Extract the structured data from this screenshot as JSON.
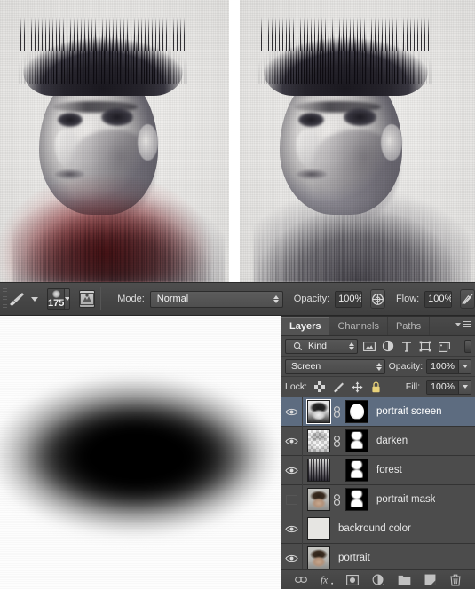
{
  "canvas": {
    "left_image": {
      "label": "portrait-with-red-overlay",
      "description": "Double exposure portrait, forest canopy hair, red painted wash over shoulders"
    },
    "right_image": {
      "label": "portrait-final-monochrome",
      "description": "Double exposure portrait, forest canopy hair and forest shoulders, no red"
    },
    "mask_preview": {
      "label": "soft-black-brush-blob-on-white"
    }
  },
  "options_bar": {
    "brush_preset_name": "brush-preset",
    "brush_size": "175",
    "brush_panel_icon": "brush-panel-icon",
    "mode_label": "Mode:",
    "mode_value": "Normal",
    "opacity_label": "Opacity:",
    "opacity_value": "100%",
    "airbrush_icon": "airbrush-icon",
    "flow_label": "Flow:",
    "flow_value": "100%",
    "pressure_icon": "pressure-size-icon"
  },
  "layers_panel": {
    "tabs": [
      {
        "label": "Layers",
        "active": true
      },
      {
        "label": "Channels",
        "active": false
      },
      {
        "label": "Paths",
        "active": false
      }
    ],
    "panel_menu_icon": "panel-menu-icon",
    "filter": {
      "kind_label": "Kind",
      "search_icon": "search-icon",
      "icons": [
        "image-filter-icon",
        "adjustment-filter-icon",
        "type-filter-icon",
        "shape-filter-icon",
        "smart-object-filter-icon"
      ],
      "toggle": "filter-enable-toggle"
    },
    "blend": {
      "mode": "Screen",
      "opacity_label": "Opacity:",
      "opacity_value": "100%"
    },
    "lock": {
      "label": "Lock:",
      "icons": [
        "lock-transparent-pixels-icon",
        "lock-image-pixels-icon",
        "lock-position-icon",
        "lock-all-icon"
      ],
      "fill_label": "Fill:",
      "fill_value": "100%"
    },
    "layers": [
      {
        "name": "portrait screen",
        "visible": true,
        "selected": true,
        "thumb": "bw-portrait-transparent",
        "linked": true,
        "mask": "blob-mask"
      },
      {
        "name": "darken",
        "visible": true,
        "selected": false,
        "thumb": "faint-transparent",
        "linked": true,
        "mask": "face-mask"
      },
      {
        "name": "forest",
        "visible": true,
        "selected": false,
        "thumb": "forest",
        "linked": false,
        "mask": "face-mask"
      },
      {
        "name": "portrait mask",
        "visible": false,
        "selected": false,
        "thumb": "color-portrait",
        "linked": true,
        "mask": "face-mask"
      },
      {
        "name": "backround color",
        "visible": true,
        "selected": false,
        "thumb": "flat-color",
        "linked": false,
        "mask": null
      },
      {
        "name": "portrait",
        "visible": true,
        "selected": false,
        "thumb": "color-portrait",
        "linked": false,
        "mask": null
      }
    ],
    "footer_icons": [
      "link-layers-icon",
      "layer-style-fx-icon",
      "add-layer-mask-icon",
      "adjustment-layer-icon",
      "new-group-icon",
      "new-layer-icon",
      "delete-layer-icon"
    ]
  },
  "colors": {
    "panel_bg": "#464646",
    "row_bg": "#4c4c4c",
    "selected_row": "#5d6c80",
    "toolbar_bg": "#474747",
    "text": "#e9e9e9",
    "red_overlay": "#c42e34"
  }
}
